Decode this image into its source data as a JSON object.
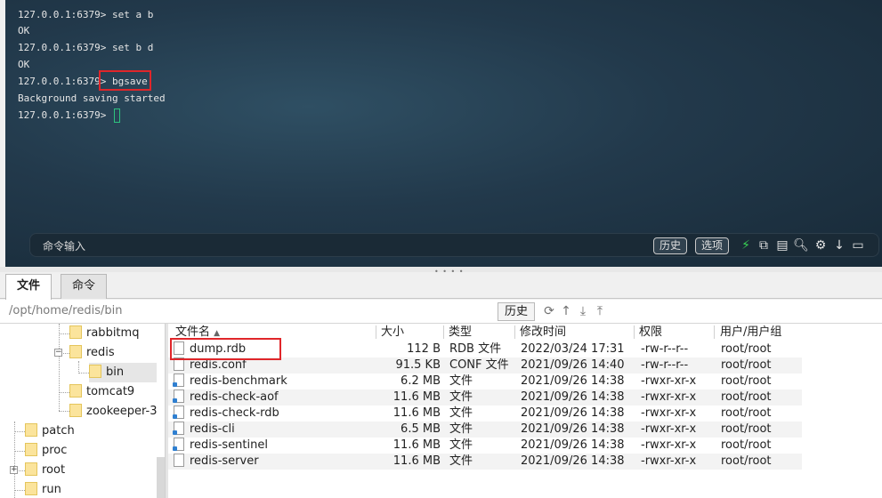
{
  "terminal": {
    "lines": [
      "127.0.0.1:6379> set a b",
      "OK",
      "127.0.0.1:6379> set b d",
      "OK",
      "127.0.0.1:6379> bgsave",
      "Background saving started",
      "127.0.0.1:6379> "
    ],
    "cursor_color": "#2ec27e",
    "highlight_color": "#e0262a"
  },
  "command_bar": {
    "placeholder": "命令输入",
    "history_label": "历史",
    "options_label": "选项",
    "icons": [
      "bolt-icon",
      "copy-icon",
      "paste-icon",
      "search-icon",
      "gear-icon",
      "arrow-down-icon",
      "window-icon"
    ]
  },
  "tabs": [
    {
      "label": "文件",
      "active": true
    },
    {
      "label": "命令",
      "active": false
    }
  ],
  "pathbar": {
    "path": "/opt/home/redis/bin",
    "history_label": "历史",
    "icons": [
      "refresh-icon",
      "up-dir-icon",
      "download-icon",
      "upload-icon"
    ]
  },
  "tree": {
    "nodes": [
      {
        "label": "rabbitmq"
      },
      {
        "label": "redis",
        "expanded": true
      },
      {
        "label": "bin",
        "selected": true
      },
      {
        "label": "tomcat9"
      },
      {
        "label": "zookeeper-3"
      },
      {
        "label": "patch"
      },
      {
        "label": "proc"
      },
      {
        "label": "root",
        "expandable": true
      },
      {
        "label": "run"
      }
    ]
  },
  "file_list": {
    "columns": [
      "文件名",
      "大小",
      "类型",
      "修改时间",
      "权限",
      "用户/用户组"
    ],
    "rows": [
      {
        "name": "dump.rdb",
        "size": "112 B",
        "type": "RDB 文件",
        "mtime": "2022/03/24 17:31",
        "perm": "-rw-r--r--",
        "owner": "root/root",
        "icon": "file-icon"
      },
      {
        "name": "redis.conf",
        "size": "91.5 KB",
        "type": "CONF 文件",
        "mtime": "2021/09/26 14:40",
        "perm": "-rw-r--r--",
        "owner": "root/root",
        "icon": "file-icon"
      },
      {
        "name": "redis-benchmark",
        "size": "6.2 MB",
        "type": "文件",
        "mtime": "2021/09/26 14:38",
        "perm": "-rwxr-xr-x",
        "owner": "root/root",
        "icon": "executable-icon"
      },
      {
        "name": "redis-check-aof",
        "size": "11.6 MB",
        "type": "文件",
        "mtime": "2021/09/26 14:38",
        "perm": "-rwxr-xr-x",
        "owner": "root/root",
        "icon": "executable-icon"
      },
      {
        "name": "redis-check-rdb",
        "size": "11.6 MB",
        "type": "文件",
        "mtime": "2021/09/26 14:38",
        "perm": "-rwxr-xr-x",
        "owner": "root/root",
        "icon": "executable-icon"
      },
      {
        "name": "redis-cli",
        "size": "6.5 MB",
        "type": "文件",
        "mtime": "2021/09/26 14:38",
        "perm": "-rwxr-xr-x",
        "owner": "root/root",
        "icon": "executable-icon"
      },
      {
        "name": "redis-sentinel",
        "size": "11.6 MB",
        "type": "文件",
        "mtime": "2021/09/26 14:38",
        "perm": "-rwxr-xr-x",
        "owner": "root/root",
        "icon": "executable-icon"
      },
      {
        "name": "redis-server",
        "size": "11.6 MB",
        "type": "文件",
        "mtime": "2021/09/26 14:38",
        "perm": "-rwxr-xr-x",
        "owner": "root/root",
        "icon": "file-icon"
      }
    ]
  }
}
